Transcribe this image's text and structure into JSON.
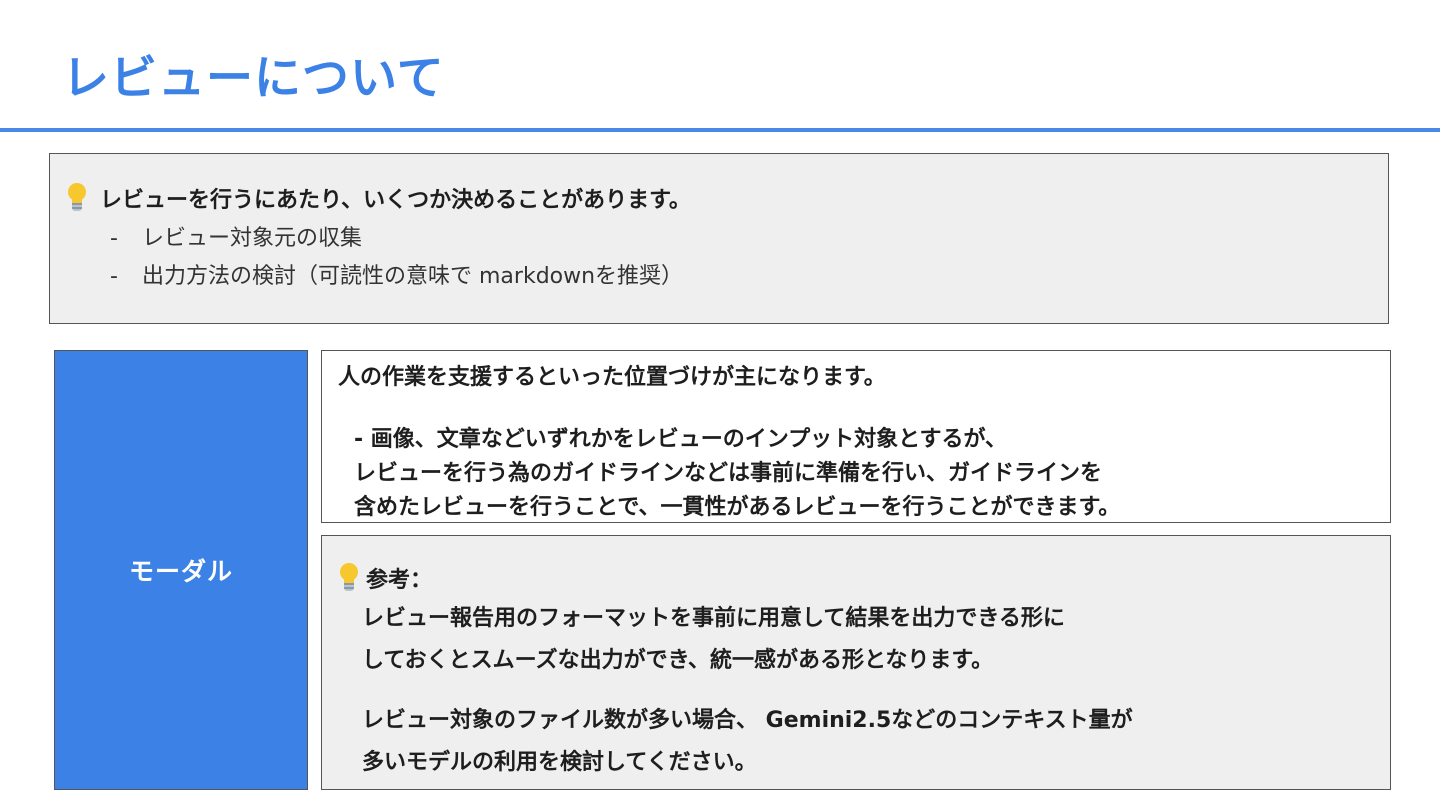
{
  "slide": {
    "title": "レビューについて",
    "colors": {
      "accent": "#3c82e6",
      "box_gray": "#efefef",
      "border": "#555555"
    }
  },
  "intro": {
    "icon": "lightbulb-icon",
    "heading": "レビューを行うにあたり、いくつか決めることがあります。",
    "items": [
      {
        "dash": "-",
        "text": "レビュー対象元の収集"
      },
      {
        "dash": "-",
        "text": "出力方法の検討（可読性の意味で markdownを推奨）"
      }
    ]
  },
  "model": {
    "label": "モーダル"
  },
  "description": {
    "heading": "人の作業を支援するといった位置づけが主になります。",
    "lines": [
      "- 画像、文章などいずれかをレビューのインプット対象とするが、",
      "レビューを行う為のガイドラインなどは事前に準備を行い、ガイドラインを",
      "含めたレビューを行うことで、一貫性があるレビューを行うことができます。"
    ]
  },
  "reference": {
    "icon": "lightbulb-icon",
    "heading": "参考：",
    "paragraph1": [
      "レビュー報告用のフォーマットを事前に用意して結果を出力できる形に",
      "しておくとスムーズな出力ができ、統一感がある形となります。"
    ],
    "paragraph2": [
      "レビュー対象のファイル数が多い場合、 Gemini2.5などのコンテキスト量が",
      "多いモデルの利用を検討してください。"
    ]
  }
}
